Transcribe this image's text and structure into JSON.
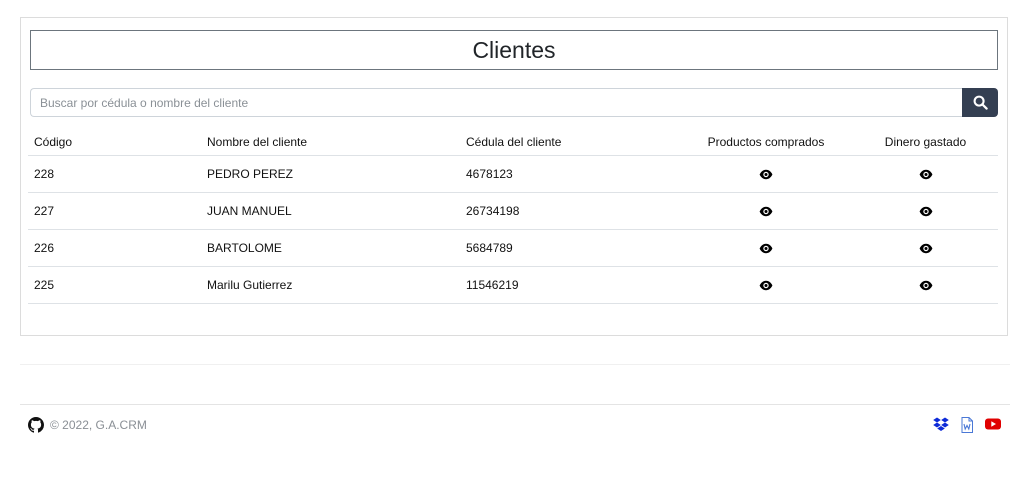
{
  "page": {
    "title": "Clientes"
  },
  "search": {
    "placeholder": "Buscar por cédula o nombre del cliente"
  },
  "table": {
    "headers": [
      "Código",
      "Nombre del cliente",
      "Cédula del cliente",
      "Productos comprados",
      "Dinero gastado"
    ],
    "rows": [
      {
        "codigo": "228",
        "nombre": "PEDRO PEREZ",
        "cedula": "4678123"
      },
      {
        "codigo": "227",
        "nombre": "JUAN MANUEL",
        "cedula": "26734198"
      },
      {
        "codigo": "226",
        "nombre": "BARTOLOME",
        "cedula": "5684789"
      },
      {
        "codigo": "225",
        "nombre": "Marilu Gutierrez",
        "cedula": "11546219"
      }
    ]
  },
  "footer": {
    "copyright": "© 2022, G.A.CRM",
    "icons": [
      "github-icon",
      "dropbox-icon",
      "word-file-icon",
      "youtube-icon"
    ]
  },
  "colors": {
    "accent": "#343f52",
    "dropbox": "#0d2ad8",
    "word": "#4a78d6",
    "youtube": "#e00000"
  }
}
